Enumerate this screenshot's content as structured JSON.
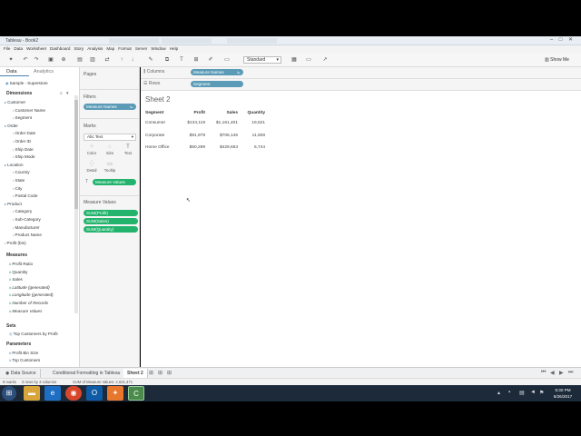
{
  "window": {
    "title": "Tableau - Book2",
    "controls": [
      "–",
      "□",
      "✕"
    ]
  },
  "menu": [
    "File",
    "Data",
    "Worksheet",
    "Dashboard",
    "Story",
    "Analysis",
    "Map",
    "Format",
    "Server",
    "Window",
    "Help"
  ],
  "toolbar": {
    "fit_select": "Standard",
    "show_me": "Show Me"
  },
  "left_panel": {
    "tabs": [
      "Data",
      "Analytics"
    ],
    "datasource": "Sample - Superstore",
    "dimensions_header": "Dimensions",
    "dimensions": [
      {
        "label": "Customer",
        "level": 0,
        "folder": true
      },
      {
        "label": "Customer Name",
        "level": 1
      },
      {
        "label": "Segment",
        "level": 1
      },
      {
        "label": "Order",
        "level": 0,
        "folder": true
      },
      {
        "label": "Order Date",
        "level": 1
      },
      {
        "label": "Order ID",
        "level": 1
      },
      {
        "label": "Ship Date",
        "level": 1
      },
      {
        "label": "Ship Mode",
        "level": 1
      },
      {
        "label": "Location",
        "level": 0,
        "folder": true
      },
      {
        "label": "Country",
        "level": 1
      },
      {
        "label": "State",
        "level": 1
      },
      {
        "label": "City",
        "level": 1
      },
      {
        "label": "Postal Code",
        "level": 1
      },
      {
        "label": "Product",
        "level": 0,
        "folder": true
      },
      {
        "label": "Category",
        "level": 1
      },
      {
        "label": "Sub-Category",
        "level": 1
      },
      {
        "label": "Manufacturer",
        "level": 1
      },
      {
        "label": "Product Name",
        "level": 1
      },
      {
        "label": "Profit (bin)",
        "level": 0
      }
    ],
    "measures_header": "Measures",
    "measures": [
      "Profit Ratio",
      "Quantity",
      "Sales",
      "Latitude (generated)",
      "Longitude (generated)",
      "Number of Records",
      "Measure Values"
    ],
    "sets_header": "Sets",
    "sets": [
      "Top Customers by Profit"
    ],
    "parameters_header": "Parameters",
    "parameters": [
      "Profit Bin Size",
      "Top Customers"
    ]
  },
  "mid_panel": {
    "pages": "Pages",
    "filters": "Filters",
    "filter_pill": "Measure Names",
    "marks": "Marks",
    "marks_type": "Abc Text",
    "mark_buttons": [
      "Color",
      "Size",
      "Text",
      "Detail",
      "Tooltip"
    ],
    "marks_pill": "Measure Values",
    "measure_values": "Measure Values",
    "mv_pills": [
      "SUM(Profit)",
      "SUM(Sales)",
      "SUM(Quantity)"
    ]
  },
  "shelves": {
    "columns_label": "Columns",
    "columns_pill": "Measure Names",
    "rows_label": "Rows",
    "rows_pill": "Segment"
  },
  "sheet": {
    "title": "Sheet 2",
    "headers": [
      "Segment",
      "Profit",
      "Sales",
      "Quantity"
    ],
    "rows": [
      [
        "Consumer",
        "$134,119",
        "$1,161,401",
        "19,521"
      ],
      [
        "Corporate",
        "$91,979",
        "$706,146",
        "11,608"
      ],
      [
        "Home Office",
        "$60,299",
        "$429,653",
        "6,744"
      ]
    ]
  },
  "tabs": {
    "datasource": "Data Source",
    "sheet1": "Conditional Formatting in Tableau",
    "sheet2": "Sheet 2"
  },
  "status": {
    "marks": "9 marks",
    "dims": "3 rows by 3 columns",
    "sum": "SUM of Measure Values: 2,621,471"
  },
  "clock": {
    "time": "5:30 PM",
    "date": "6/26/2017"
  }
}
